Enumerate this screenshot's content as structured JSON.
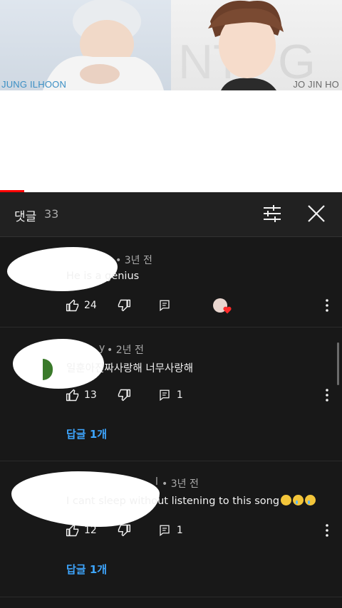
{
  "video": {
    "left_caption": "JUNG ILHOON",
    "right_caption": "JO JIN HO",
    "progress_percent": 7
  },
  "comments_panel": {
    "title": "댓글",
    "count": "33",
    "sort_icon": "sort-icon",
    "close_icon": "close-icon"
  },
  "comments": [
    {
      "author_visible_suffix": "",
      "time": "• 3년 전",
      "text": "He is a genius",
      "likes": "24",
      "replies_count": "",
      "creator_heart": true
    },
    {
      "author_visible_suffix": "y",
      "time": "• 2년 전",
      "text": "일훈아진짜사랑해 너무사랑해",
      "likes": "13",
      "replies_count": "1",
      "reply_link": "답글 1개"
    },
    {
      "author_visible_suffix": "l",
      "time": "• 3년 전",
      "text": "I cant sleep without listening to this song",
      "likes": "12",
      "replies_count": "1",
      "reply_link": "답글 1개"
    }
  ],
  "colors": {
    "background": "#181818",
    "header": "#212121",
    "accent_link": "#3ea6ff",
    "progress": "#ff0000"
  }
}
